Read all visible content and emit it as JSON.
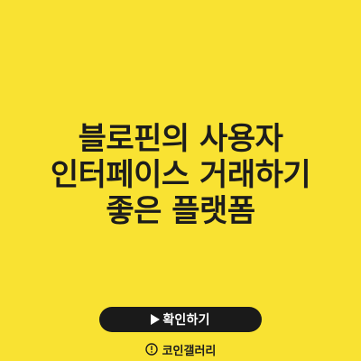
{
  "title": {
    "lines": [
      "블로핀의 사용자",
      "인터페이스 거래하기",
      "좋은 플랫폼"
    ]
  },
  "cta": {
    "label": "확인하기",
    "icon": "play-icon"
  },
  "brand": {
    "name": "코인갤러리",
    "icon": "alert-circle-icon"
  },
  "colors": {
    "background": "#f9e232",
    "button": "#1a1a1a",
    "text": "#1c1c1c"
  }
}
